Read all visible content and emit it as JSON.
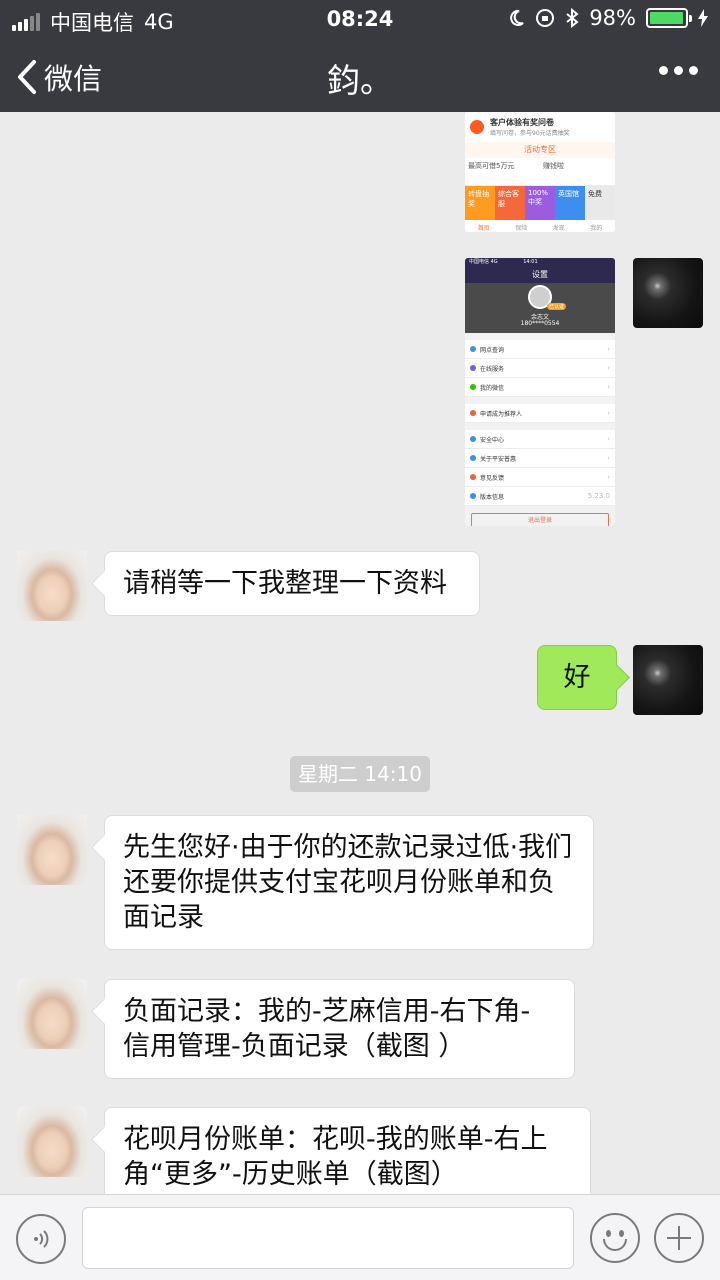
{
  "status_bar": {
    "carrier": "中国电信",
    "network": "4G",
    "time": "08:24",
    "battery": "98%",
    "battery_level": 0.98
  },
  "nav": {
    "back_label": "微信",
    "title": "鈞。"
  },
  "chat": {
    "images": [
      {
        "sender": "me",
        "title": "客户体验有奖问卷",
        "subtitle": "填写问卷，参与90元话费抽奖",
        "section": "活动专区",
        "row": [
          "最高可借5万元",
          "赚钱啦"
        ],
        "tiles": [
          "转盘抽奖",
          "综合客服",
          "100%中奖",
          "英国馆",
          "免费"
        ],
        "tabs": [
          "首页",
          "保险",
          "发现",
          "我的"
        ]
      },
      {
        "sender": "me",
        "status": "中国电信 4G",
        "time": "14:01",
        "title": "设置",
        "name": "余志文",
        "phone": "180****0554",
        "badge": "已认证",
        "items": [
          "网点查询",
          "在线服务",
          "我的微信",
          "申请成为推荐人",
          "安全中心",
          "关于平安普惠",
          "意见反馈",
          "版本信息"
        ],
        "version": "5.23.0",
        "logout": "退出登录"
      }
    ],
    "messages": [
      {
        "sender": "them",
        "text": "请稍等一下我整理一下资料"
      },
      {
        "sender": "me",
        "text": "好"
      },
      {
        "sender": "them",
        "text": "先生您好·由于你的还款记录过低·我们还要你提供支付宝花呗月份账单和负面记录"
      },
      {
        "sender": "them",
        "text": "负面记录：我的-芝麻信用-右下角-信用管理-负面记录（截图 ）"
      },
      {
        "sender": "them",
        "text": "花呗月份账单：花呗-我的账单-右上角“更多”-历史账单（截图）"
      }
    ],
    "timestamp": "星期二 14:10"
  },
  "icons": {
    "back": "chevron-left-icon",
    "more": "more-dots-icon",
    "voice": "voice-icon",
    "emoji": "emoji-icon",
    "plus": "plus-icon"
  }
}
